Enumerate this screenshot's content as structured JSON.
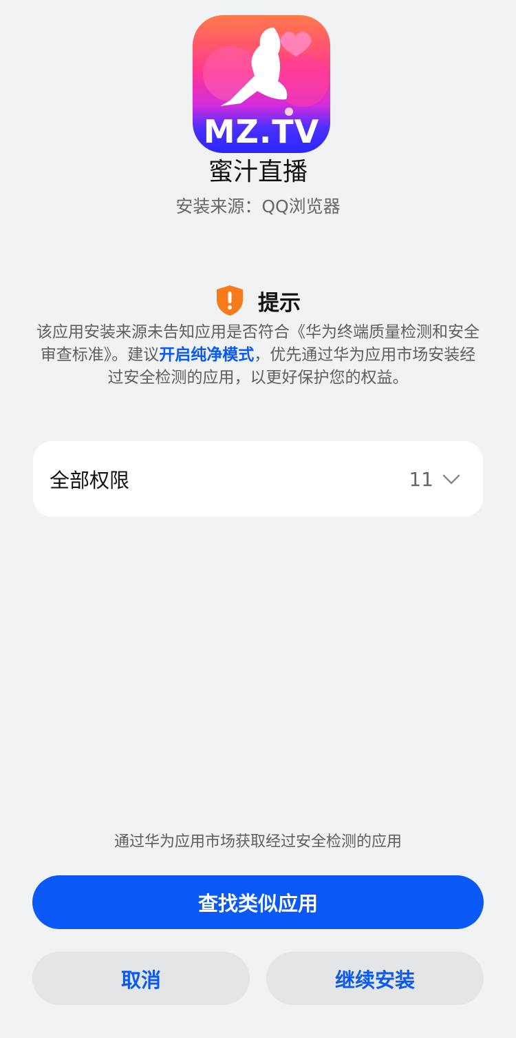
{
  "app": {
    "icon_text": "MZ.TV",
    "name": "蜜汁直播",
    "install_source": "安装来源：QQ浏览器"
  },
  "hint": {
    "icon": "shield-warning-icon",
    "title": "提示",
    "body_before": "该应用安装来源未告知应用是否符合《华为终端质量检测和安全审查标准》。建议",
    "body_link": "开启纯净模式",
    "body_after": "，优先通过华为应用市场安装经过安全检测的应用，以更好保护您的权益。"
  },
  "permissions": {
    "label": "全部权限",
    "count": "11",
    "icon": "chevron-down-icon"
  },
  "market_note": "通过华为应用市场获取经过安全检测的应用",
  "buttons": {
    "find_similar": "查找类似应用",
    "cancel": "取消",
    "continue_install": "继续安装"
  },
  "colors": {
    "accent": "#0a59f7",
    "background": "#f1f2f3",
    "warning": "#f77a1b"
  }
}
